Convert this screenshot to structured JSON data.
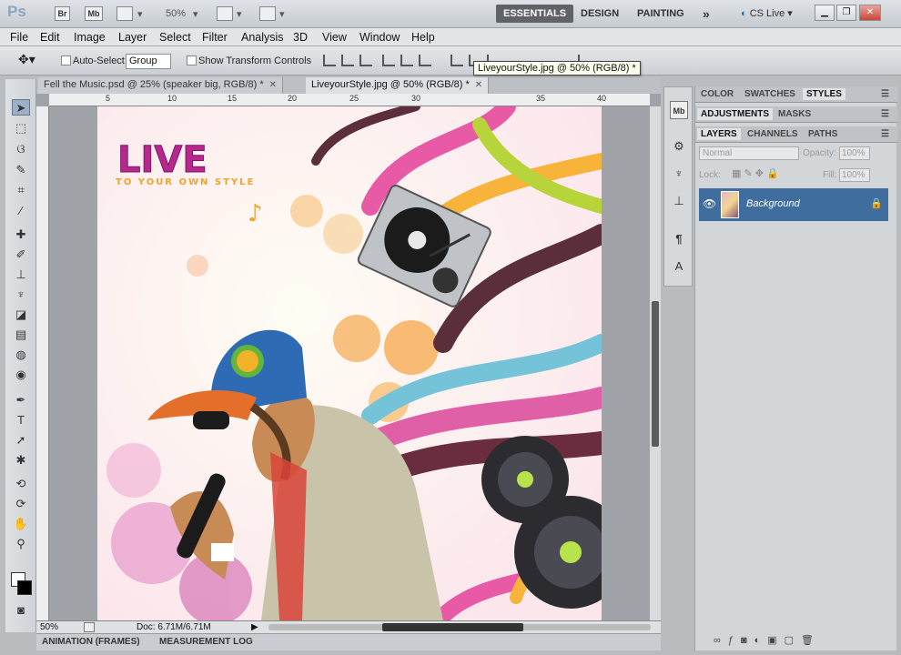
{
  "appbar": {
    "logo": "Ps",
    "bridge": "Br",
    "minibridge": "Mb",
    "zoom": "50%",
    "workspaces": [
      "ESSENTIALS",
      "DESIGN",
      "PAINTING"
    ],
    "more": "»",
    "cslive": "CS Live"
  },
  "menu": [
    "File",
    "Edit",
    "Image",
    "Layer",
    "Select",
    "Filter",
    "Analysis",
    "3D",
    "View",
    "Window",
    "Help"
  ],
  "options": {
    "auto_select_label": "Auto-Select:",
    "auto_select_value": "Group",
    "transform_label": "Show Transform Controls"
  },
  "tooltip": "LiveyourStyle.jpg @ 50% (RGB/8) *",
  "documents": {
    "tabs": [
      {
        "label": "Fell the Music.psd @ 25% (speaker big, RGB/8) *"
      },
      {
        "label": "LiveyourStyle.jpg @ 50% (RGB/8) *"
      }
    ],
    "ruler_marks": [
      "5",
      "10",
      "15",
      "20",
      "25",
      "30",
      "35",
      "40"
    ],
    "artwork_title": "LIVE",
    "artwork_subtitle": "TO YOUR OWN STYLE"
  },
  "status": {
    "zoom": "50%",
    "doc": "Doc: 6.71M/6.71M"
  },
  "bottom_tabs": [
    "ANIMATION (FRAMES)",
    "MEASUREMENT LOG"
  ],
  "panels": {
    "group1": [
      "COLOR",
      "SWATCHES",
      "STYLES"
    ],
    "group2": [
      "ADJUSTMENTS",
      "MASKS"
    ],
    "group3": [
      "LAYERS",
      "CHANNELS",
      "PATHS"
    ],
    "blend_mode": "Normal",
    "opacity_label": "Opacity:",
    "opacity_value": "100%",
    "lock_label": "Lock:",
    "fill_label": "Fill:",
    "fill_value": "100%",
    "layer_name": "Background"
  },
  "colors": {
    "accent": "#3f6d9e",
    "workspace_active": "#5f6266"
  }
}
